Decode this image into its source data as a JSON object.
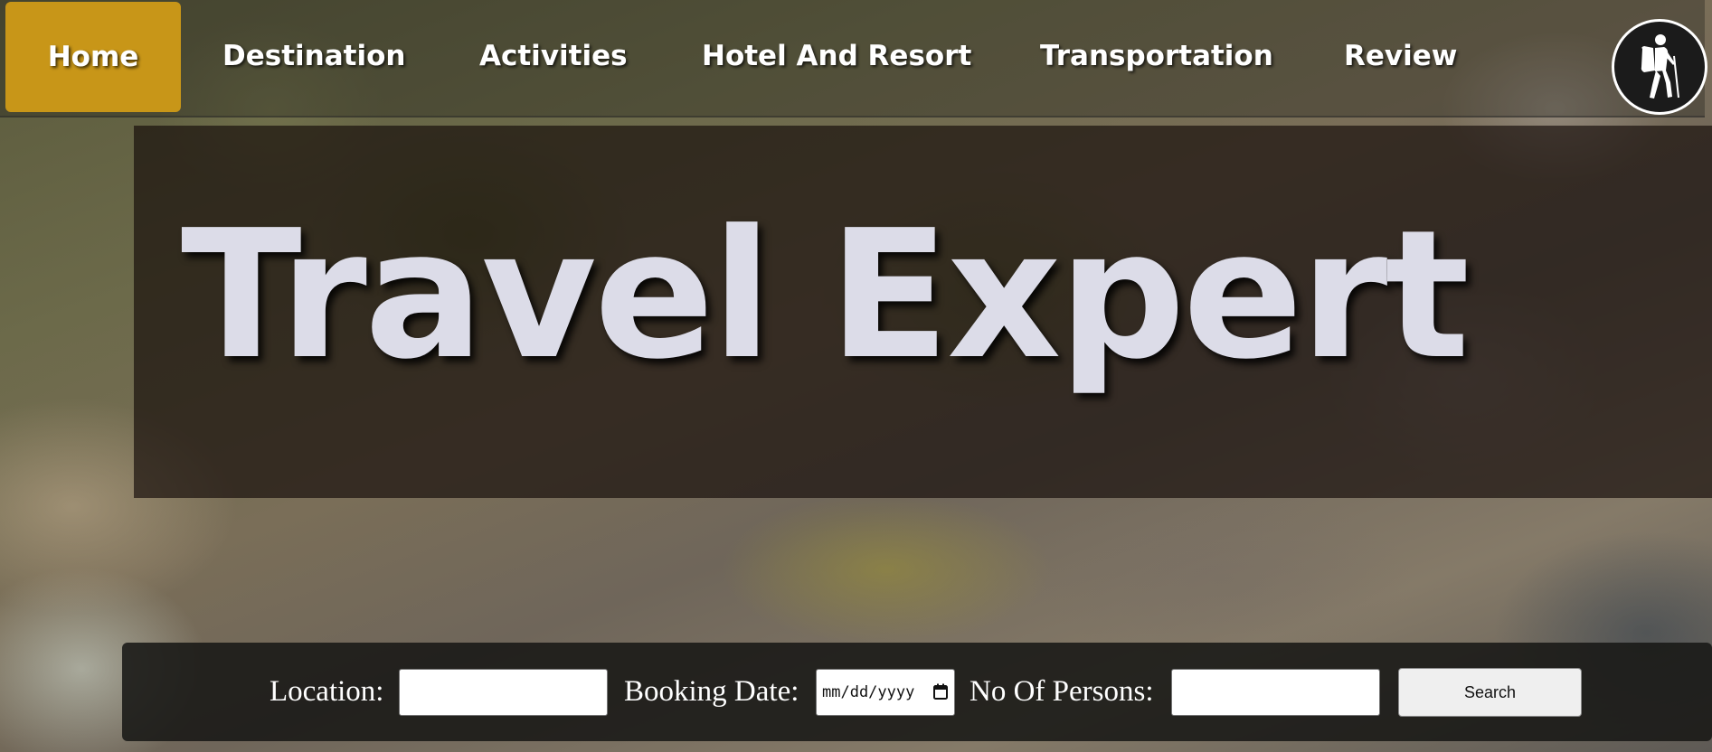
{
  "nav": {
    "items": [
      {
        "label": "Home",
        "active": true
      },
      {
        "label": "Destination"
      },
      {
        "label": "Activities"
      },
      {
        "label": "Hotel And Resort"
      },
      {
        "label": "Transportation"
      },
      {
        "label": "Review"
      }
    ],
    "logo_icon": "backpacker-logo-icon",
    "active_color": "#c89618"
  },
  "hero": {
    "title": "Travel Expert"
  },
  "search": {
    "location_label": "Location:",
    "location_value": "",
    "date_label": "Booking Date:",
    "date_placeholder": "mm/dd/yyyy",
    "persons_label": "No Of Persons:",
    "persons_value": "",
    "button_label": "Search"
  }
}
